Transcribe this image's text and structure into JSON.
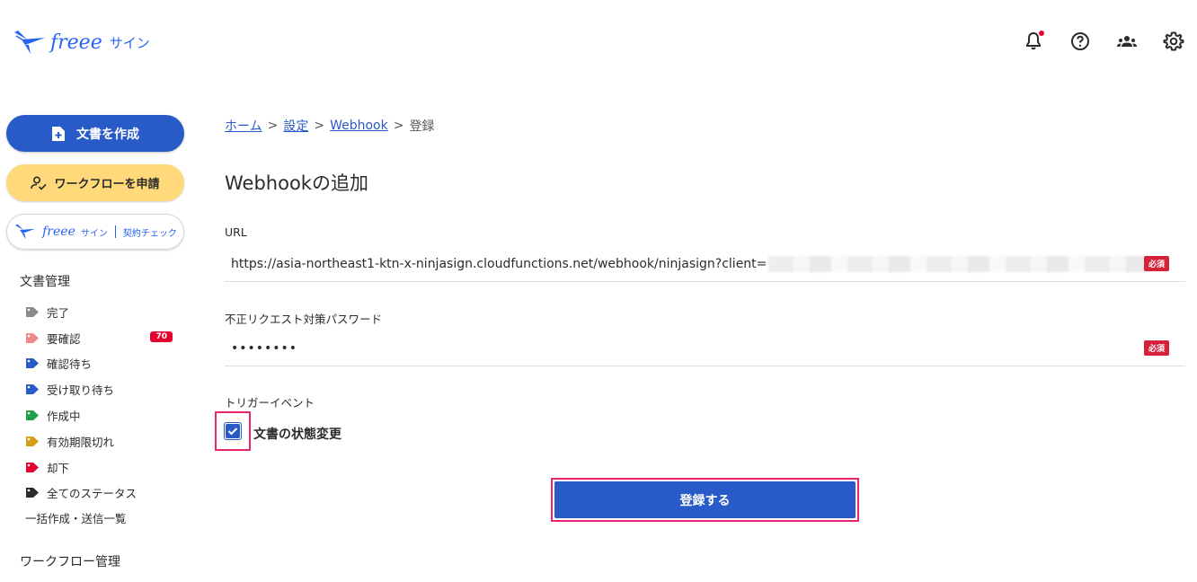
{
  "header": {
    "logo_text": "freee",
    "logo_sub": "サイン"
  },
  "sidebar": {
    "create_label": "文書を作成",
    "workflow_label": "ワークフローを申請",
    "check_brand": "freee",
    "check_brand_sub": "サイン",
    "check_label": "契約チェック",
    "doc_section": "文書管理",
    "items": [
      {
        "label": "完了",
        "color": "#8c8c8c"
      },
      {
        "label": "要確認",
        "color": "#f08a8a",
        "badge": "70"
      },
      {
        "label": "確認待ち",
        "color": "#285ac8"
      },
      {
        "label": "受け取り待ち",
        "color": "#285ac8"
      },
      {
        "label": "作成中",
        "color": "#1ea04a"
      },
      {
        "label": "有効期限切れ",
        "color": "#d4a017"
      },
      {
        "label": "却下",
        "color": "#e6002d"
      },
      {
        "label": "全てのステータス",
        "color": "#2b2b2b"
      }
    ],
    "bulk_label": "一括作成・送信一覧",
    "workflow_section": "ワークフロー管理"
  },
  "breadcrumb": {
    "home": "ホーム",
    "settings": "設定",
    "webhook": "Webhook",
    "current": "登録",
    "sep": ">"
  },
  "form": {
    "title": "Webhookの追加",
    "url_label": "URL",
    "url_value": "https://asia-northeast1-ktn-x-ninjasign.cloudfunctions.net/webhook/ninjasign?client=",
    "required": "必須",
    "password_label": "不正リクエスト対策パスワード",
    "password_value": "••••••••",
    "trigger_label": "トリガーイベント",
    "trigger_option": "文書の状態変更",
    "submit_label": "登録する"
  },
  "colors": {
    "primary": "#285ac8",
    "accent_yellow": "#ffd97a",
    "highlight": "#e8246e",
    "required_red": "#d6213a"
  }
}
